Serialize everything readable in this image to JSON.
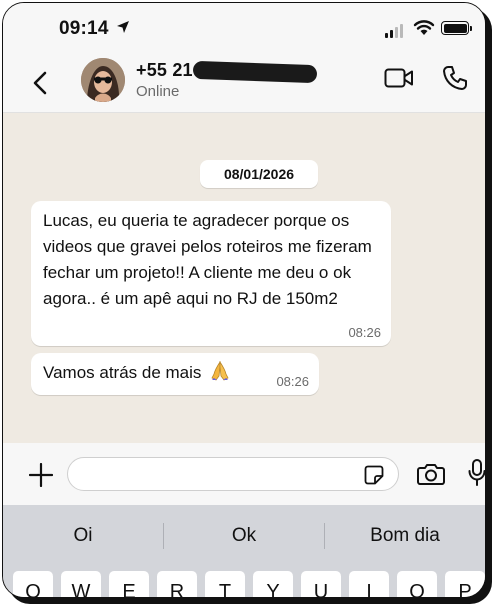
{
  "status_bar": {
    "time": "09:14",
    "icons": [
      "location-arrow-icon",
      "cellular-signal-icon",
      "wifi-icon",
      "battery-icon"
    ]
  },
  "header": {
    "contact_name": "+55 21",
    "contact_status": "Online",
    "icons": [
      "back-chevron-icon",
      "avatar",
      "video-call-icon",
      "phone-call-icon"
    ]
  },
  "chat": {
    "date_chip": "08/01/2026",
    "messages": [
      {
        "text": "Lucas, eu queria te agradecer porque os videos que gravei pelos roteiros me fizeram fechar um projeto!! A cliente me deu o ok agora.. é um apê aqui no RJ de 150m2",
        "time": "08:26"
      },
      {
        "text": "Vamos atrás de mais",
        "emoji": "pray-hands-emoji",
        "time": "08:26"
      }
    ]
  },
  "composer": {
    "value": "",
    "icons": [
      "plus-icon",
      "sticker-icon",
      "camera-icon",
      "microphone-icon"
    ]
  },
  "keyboard": {
    "suggestions": [
      "Oi",
      "Ok",
      "Bom dia"
    ],
    "keys": [
      "Q",
      "W",
      "E",
      "R",
      "T",
      "Y",
      "U",
      "I",
      "O",
      "P"
    ]
  },
  "colors": {
    "chat_background": "#efeae2",
    "bubble": "#ffffff",
    "bars": "#f7f7f7",
    "keyboard": "#d3d5da"
  }
}
